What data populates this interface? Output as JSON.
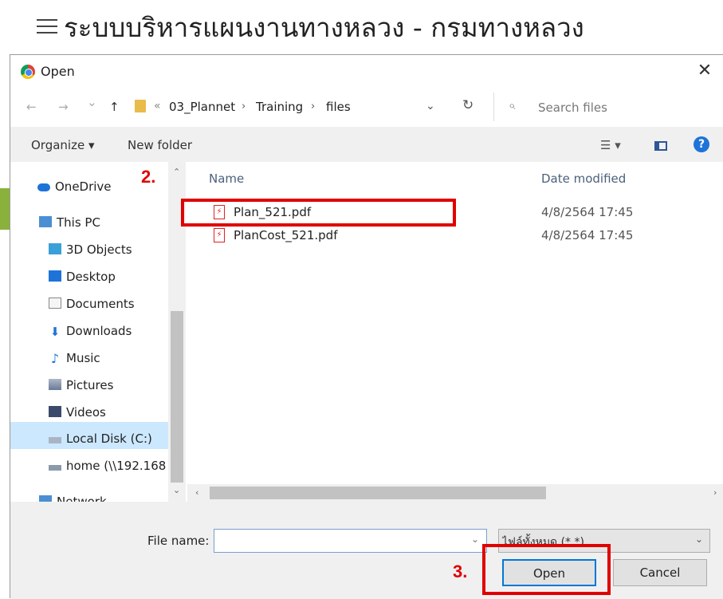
{
  "page": {
    "title": "ระบบบริหารแผนงานทางหลวง - กรมทางหลวง"
  },
  "dialog": {
    "title": "Open",
    "close": "✕",
    "nav": {
      "back": "←",
      "forward": "→",
      "recent": "⌄",
      "up": "↑"
    },
    "breadcrumb": {
      "overflow": "«",
      "items": [
        "03_Plannet",
        "Training",
        "files"
      ],
      "separator": "›"
    },
    "address_dropdown": "⌄",
    "refresh": "↻",
    "search_placeholder": "Search files",
    "toolbar": {
      "organize": "Organize ▾",
      "new_folder": "New folder",
      "view": "☰ ▾",
      "help": "?"
    },
    "sidebar": {
      "items": [
        {
          "label": "OneDrive",
          "icon": "cloud-icon"
        },
        {
          "label": "This PC",
          "icon": "computer-icon"
        },
        {
          "label": "3D Objects",
          "icon": "cube-icon"
        },
        {
          "label": "Desktop",
          "icon": "desktop-icon"
        },
        {
          "label": "Documents",
          "icon": "document-icon"
        },
        {
          "label": "Downloads",
          "icon": "download-icon"
        },
        {
          "label": "Music",
          "icon": "music-icon"
        },
        {
          "label": "Pictures",
          "icon": "picture-icon"
        },
        {
          "label": "Videos",
          "icon": "video-icon"
        },
        {
          "label": "Local Disk (C:)",
          "icon": "drive-icon"
        },
        {
          "label": "home (\\\\192.168",
          "icon": "network-drive-icon"
        },
        {
          "label": "Network",
          "icon": "network-icon"
        }
      ],
      "selected": "Local Disk (C:)"
    },
    "columns": {
      "name": "Name",
      "date": "Date modified"
    },
    "files": [
      {
        "name": "Plan_521.pdf",
        "date": "4/8/2564 17:45"
      },
      {
        "name": "PlanCost_521.pdf",
        "date": "4/8/2564 17:45"
      }
    ],
    "footer": {
      "file_name_label": "File name:",
      "file_name_value": "",
      "filter": "ไฟล์ทั้งหมด (*.*)",
      "open": "Open",
      "cancel": "Cancel"
    }
  },
  "annotations": {
    "step2": "2.",
    "step3": "3."
  },
  "colors": {
    "highlight": "#e00000",
    "selection": "#cce8ff",
    "accent": "#0078d7"
  }
}
